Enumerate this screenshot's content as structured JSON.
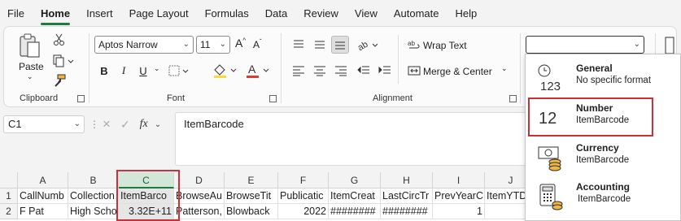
{
  "menu": [
    "File",
    "Home",
    "Insert",
    "Page Layout",
    "Formulas",
    "Data",
    "Review",
    "View",
    "Automate",
    "Help"
  ],
  "ribbon": {
    "clipboard": {
      "paste_label": "Paste",
      "group_label": "Clipboard"
    },
    "font": {
      "name": "Aptos Narrow",
      "size": "11",
      "group_label": "Font",
      "bold": "B",
      "italic": "I",
      "underline": "U",
      "font_color_letter": "A",
      "highlight_color": "#ffd83b",
      "font_color": "#e03a2f"
    },
    "alignment": {
      "wrap_text": "Wrap Text",
      "merge_center": "Merge & Center",
      "group_label": "Alignment"
    },
    "number_format": {
      "value": ""
    }
  },
  "formula_bar": {
    "name_box": "C1",
    "fx": "fx",
    "content": "ItemBarcode"
  },
  "grid": {
    "columns": [
      "A",
      "B",
      "C",
      "D",
      "E",
      "F",
      "G",
      "H",
      "I",
      "J"
    ],
    "selected_column": "C",
    "rows": [
      {
        "num": "1",
        "cells": [
          "CallNumb",
          "Collection",
          "ItemBarco",
          "BrowseAu",
          "BrowseTit",
          "Publicatic",
          "ItemCreat",
          "LastCircTr",
          "PrevYearC",
          "ItemYTD"
        ]
      },
      {
        "num": "2",
        "cells": [
          "F Pat",
          "High Scho",
          "3.32E+11",
          "Patterson,",
          "Blowback",
          "2022",
          "########",
          "########",
          "1",
          ""
        ]
      }
    ]
  },
  "dropdown": {
    "items": [
      {
        "title": "General",
        "subtitle": "No specific format",
        "icon": "clock-123-icon"
      },
      {
        "title": "Number",
        "subtitle": "ItemBarcode",
        "icon": "number-12-icon",
        "highlighted": true
      },
      {
        "title": "Currency",
        "subtitle": "ItemBarcode",
        "icon": "currency-icon"
      },
      {
        "title": "Accounting",
        "subtitle": "ItemBarcode",
        "icon": "calculator-icon"
      }
    ]
  },
  "colors": {
    "accent": "#1f7a3f",
    "highlight_box": "#c8323a"
  }
}
